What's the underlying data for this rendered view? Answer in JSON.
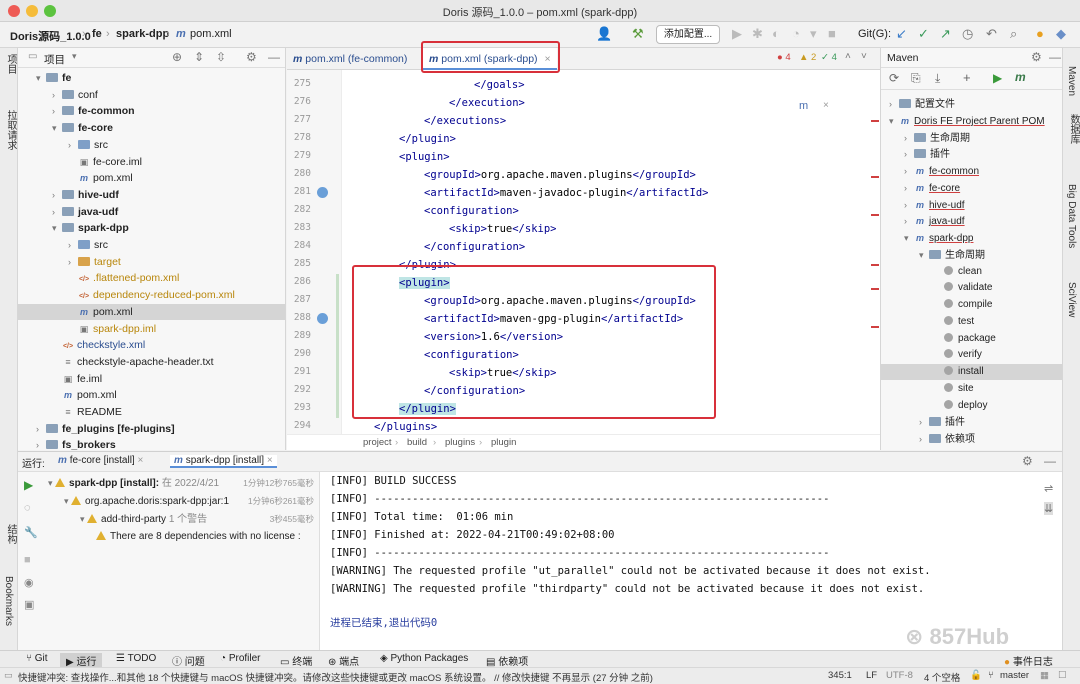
{
  "window": {
    "title": "Doris 源码_1.0.0 – pom.xml (spark-dpp)"
  },
  "toolbar": {
    "breadcrumbs": [
      "Doris源码_1.0.0",
      "fe",
      "spark-dpp",
      "pom.xml"
    ],
    "add_config": "添加配置...",
    "git_label": "Git(G):"
  },
  "left_stripe": {
    "project": "项目",
    "pull_requests": "拉取请求",
    "structure": "结构",
    "bookmarks": "Bookmarks"
  },
  "right_stripe": {
    "maven": "Maven",
    "database": "数据库",
    "big_data": "Big Data Tools",
    "sciview": "SciView"
  },
  "project": {
    "title": "项目",
    "rows": [
      {
        "label": "fe",
        "kind": "folder",
        "indent": 0,
        "arrow": "▾",
        "bold": true
      },
      {
        "label": "conf",
        "kind": "folder",
        "indent": 1,
        "arrow": "›"
      },
      {
        "label": "fe-common",
        "kind": "folder",
        "indent": 1,
        "arrow": "›",
        "bold": true
      },
      {
        "label": "fe-core",
        "kind": "folder",
        "indent": 1,
        "arrow": "▾",
        "bold": true
      },
      {
        "label": "src",
        "kind": "src",
        "indent": 2,
        "arrow": "›"
      },
      {
        "label": "fe-core.iml",
        "kind": "iml",
        "indent": 2,
        "arrow": ""
      },
      {
        "label": "pom.xml",
        "kind": "m",
        "indent": 2,
        "arrow": ""
      },
      {
        "label": "hive-udf",
        "kind": "folder",
        "indent": 1,
        "arrow": "›",
        "bold": true
      },
      {
        "label": "java-udf",
        "kind": "folder",
        "indent": 1,
        "arrow": "›",
        "bold": true
      },
      {
        "label": "spark-dpp",
        "kind": "folder",
        "indent": 1,
        "arrow": "▾",
        "bold": true
      },
      {
        "label": "src",
        "kind": "src",
        "indent": 2,
        "arrow": "›"
      },
      {
        "label": "target",
        "kind": "target",
        "indent": 2,
        "arrow": "›"
      },
      {
        "label": ".flattened-pom.xml",
        "kind": "xml",
        "indent": 2,
        "arrow": ""
      },
      {
        "label": "dependency-reduced-pom.xml",
        "kind": "xml",
        "indent": 2,
        "arrow": ""
      },
      {
        "label": "pom.xml",
        "kind": "m",
        "indent": 2,
        "arrow": "",
        "selected": true
      },
      {
        "label": "spark-dpp.iml",
        "kind": "iml",
        "indent": 2,
        "arrow": ""
      },
      {
        "label": "checkstyle.xml",
        "kind": "xml",
        "indent": 1,
        "arrow": ""
      },
      {
        "label": "checkstyle-apache-header.txt",
        "kind": "txt",
        "indent": 1,
        "arrow": ""
      },
      {
        "label": "fe.iml",
        "kind": "iml",
        "indent": 1,
        "arrow": ""
      },
      {
        "label": "pom.xml",
        "kind": "m",
        "indent": 1,
        "arrow": ""
      },
      {
        "label": "README",
        "kind": "txt",
        "indent": 1,
        "arrow": ""
      },
      {
        "label": "fe_plugins [fe-plugins]",
        "kind": "folder",
        "indent": 0,
        "arrow": "›",
        "bold": true
      },
      {
        "label": "fs_brokers",
        "kind": "folder",
        "indent": 0,
        "arrow": "›",
        "bold": true
      }
    ]
  },
  "editor": {
    "tabs": [
      "pom.xml (fe-common)",
      "pom.xml (spark-dpp)"
    ],
    "inspections": {
      "errors": "4",
      "warnings": "2",
      "ok": "4"
    },
    "lines": [
      {
        "n": "275",
        "indent": 6,
        "parts": [
          [
            "tag",
            "</goals>"
          ]
        ]
      },
      {
        "n": "276",
        "indent": 5,
        "parts": [
          [
            "tag",
            "</execution>"
          ]
        ]
      },
      {
        "n": "277",
        "indent": 4,
        "parts": [
          [
            "tag",
            "</executions>"
          ]
        ]
      },
      {
        "n": "278",
        "indent": 3,
        "parts": [
          [
            "tag",
            "</plugin>"
          ]
        ]
      },
      {
        "n": "279",
        "indent": 3,
        "parts": [
          [
            "tag",
            "<plugin>"
          ]
        ]
      },
      {
        "n": "280",
        "indent": 4,
        "parts": [
          [
            "tag",
            "<groupId>"
          ],
          [
            "txt",
            "org.apache.maven.plugins"
          ],
          [
            "tag",
            "</groupId>"
          ]
        ]
      },
      {
        "n": "281",
        "indent": 4,
        "parts": [
          [
            "tag",
            "<artifactId>"
          ],
          [
            "txt",
            "maven-javadoc-plugin"
          ],
          [
            "tag",
            "</artifactId>"
          ]
        ]
      },
      {
        "n": "282",
        "indent": 4,
        "parts": [
          [
            "tag",
            "<configuration>"
          ]
        ]
      },
      {
        "n": "283",
        "indent": 5,
        "parts": [
          [
            "tag",
            "<skip>"
          ],
          [
            "txt",
            "true"
          ],
          [
            "tag",
            "</skip>"
          ]
        ]
      },
      {
        "n": "284",
        "indent": 4,
        "parts": [
          [
            "tag",
            "</configuration>"
          ]
        ]
      },
      {
        "n": "285",
        "indent": 3,
        "parts": [
          [
            "tag",
            "</plugin>"
          ]
        ]
      },
      {
        "n": "286",
        "indent": 3,
        "parts": [
          [
            "tagbg",
            "<plugin>"
          ]
        ]
      },
      {
        "n": "287",
        "indent": 4,
        "parts": [
          [
            "tag",
            "<groupId>"
          ],
          [
            "txt",
            "org.apache.maven.plugins"
          ],
          [
            "tag",
            "</groupId>"
          ]
        ]
      },
      {
        "n": "288",
        "indent": 4,
        "parts": [
          [
            "tag",
            "<artifactId>"
          ],
          [
            "txt",
            "maven-gpg-plugin"
          ],
          [
            "tag",
            "</artifactId>"
          ]
        ]
      },
      {
        "n": "289",
        "indent": 4,
        "parts": [
          [
            "tag",
            "<version>"
          ],
          [
            "txt",
            "1.6"
          ],
          [
            "tag",
            "</version>"
          ]
        ]
      },
      {
        "n": "290",
        "indent": 4,
        "parts": [
          [
            "tag",
            "<configuration>"
          ]
        ]
      },
      {
        "n": "291",
        "indent": 5,
        "parts": [
          [
            "tag",
            "<skip>"
          ],
          [
            "txt",
            "true"
          ],
          [
            "tag",
            "</skip>"
          ]
        ]
      },
      {
        "n": "292",
        "indent": 4,
        "parts": [
          [
            "tag",
            "</configuration>"
          ]
        ]
      },
      {
        "n": "293",
        "indent": 3,
        "parts": [
          [
            "tagbg",
            "</plugin>"
          ]
        ]
      },
      {
        "n": "294",
        "indent": 2,
        "parts": [
          [
            "tag",
            "</plugins>"
          ]
        ]
      }
    ],
    "breadcrumb": [
      "project",
      "build",
      "plugins",
      "plugin"
    ]
  },
  "maven": {
    "title": "Maven",
    "rows": [
      {
        "label": "配置文件",
        "indent": 0,
        "arrow": "›",
        "icon": "folder"
      },
      {
        "label": "Doris FE Project Parent POM",
        "indent": 0,
        "arrow": "▾",
        "icon": "m",
        "ul": true
      },
      {
        "label": "生命周期",
        "indent": 1,
        "arrow": "›",
        "icon": "folder"
      },
      {
        "label": "插件",
        "indent": 1,
        "arrow": "›",
        "icon": "folder"
      },
      {
        "label": "fe-common",
        "indent": 1,
        "arrow": "›",
        "icon": "m",
        "ul": true
      },
      {
        "label": "fe-core",
        "indent": 1,
        "arrow": "›",
        "icon": "m",
        "ul": true
      },
      {
        "label": "hive-udf",
        "indent": 1,
        "arrow": "›",
        "icon": "m",
        "ul": true
      },
      {
        "label": "java-udf",
        "indent": 1,
        "arrow": "›",
        "icon": "m",
        "ul": true
      },
      {
        "label": "spark-dpp",
        "indent": 1,
        "arrow": "▾",
        "icon": "m",
        "ul": true
      },
      {
        "label": "生命周期",
        "indent": 2,
        "arrow": "▾",
        "icon": "folder"
      },
      {
        "label": "clean",
        "indent": 3,
        "arrow": "",
        "icon": "gear"
      },
      {
        "label": "validate",
        "indent": 3,
        "arrow": "",
        "icon": "gear"
      },
      {
        "label": "compile",
        "indent": 3,
        "arrow": "",
        "icon": "gear"
      },
      {
        "label": "test",
        "indent": 3,
        "arrow": "",
        "icon": "gear"
      },
      {
        "label": "package",
        "indent": 3,
        "arrow": "",
        "icon": "gear"
      },
      {
        "label": "verify",
        "indent": 3,
        "arrow": "",
        "icon": "gear"
      },
      {
        "label": "install",
        "indent": 3,
        "arrow": "",
        "icon": "gear",
        "selected": true
      },
      {
        "label": "site",
        "indent": 3,
        "arrow": "",
        "icon": "gear"
      },
      {
        "label": "deploy",
        "indent": 3,
        "arrow": "",
        "icon": "gear"
      },
      {
        "label": "插件",
        "indent": 2,
        "arrow": "›",
        "icon": "folder"
      },
      {
        "label": "依赖项",
        "indent": 2,
        "arrow": "›",
        "icon": "folder"
      }
    ]
  },
  "run": {
    "label": "运行:",
    "tabs": [
      "fe-core [install]",
      "spark-dpp [install]"
    ],
    "tree": [
      {
        "text": "spark-dpp [install]:",
        "sub": "在 2022/4/21",
        "time": "1分钟12秒765毫秒",
        "indent": 0
      },
      {
        "text": "org.apache.doris:spark-dpp:jar:1",
        "sub": "",
        "time": "1分钟6秒261毫秒",
        "indent": 1
      },
      {
        "text": "add-third-party",
        "sub": "1 个警告",
        "time": "3秒455毫秒",
        "indent": 2
      },
      {
        "text": "There are 8 dependencies with no license :",
        "sub": "",
        "time": "",
        "indent": 3
      }
    ],
    "console": [
      "[INFO] BUILD SUCCESS",
      "[INFO] ------------------------------------------------------------------------",
      "[INFO] Total time:  01:06 min",
      "[INFO] Finished at: 2022-04-21T00:49:02+08:00",
      "[INFO] ------------------------------------------------------------------------",
      "[WARNING] The requested profile \"ut_parallel\" could not be activated because it does not exist.",
      "[WARNING] The requested profile \"thirdparty\" could not be activated because it does not exist.",
      "",
      "进程已结束,退出代码0"
    ]
  },
  "toolwindows": [
    "Git",
    "运行",
    "TODO",
    "问题",
    "Profiler",
    "终端",
    "端点",
    "Python Packages",
    "依赖项"
  ],
  "event_log": "事件日志",
  "status": {
    "message": "快捷键冲突: 查找操作...和其他 18 个快捷键与 macOS 快捷键冲突。请修改这些快捷键或更改 macOS 系统设置。 // 修改快捷键   不再显示 (27 分钟 之前)",
    "position": "345:1",
    "line_sep": "LF",
    "encoding": "UTF-8",
    "indent": "4 个空格",
    "branch": "master"
  },
  "watermark": "857Hub",
  "colors": {
    "accent": "#5a8fd8",
    "highlight_box": "#d8303a",
    "tag": "#00008f"
  }
}
